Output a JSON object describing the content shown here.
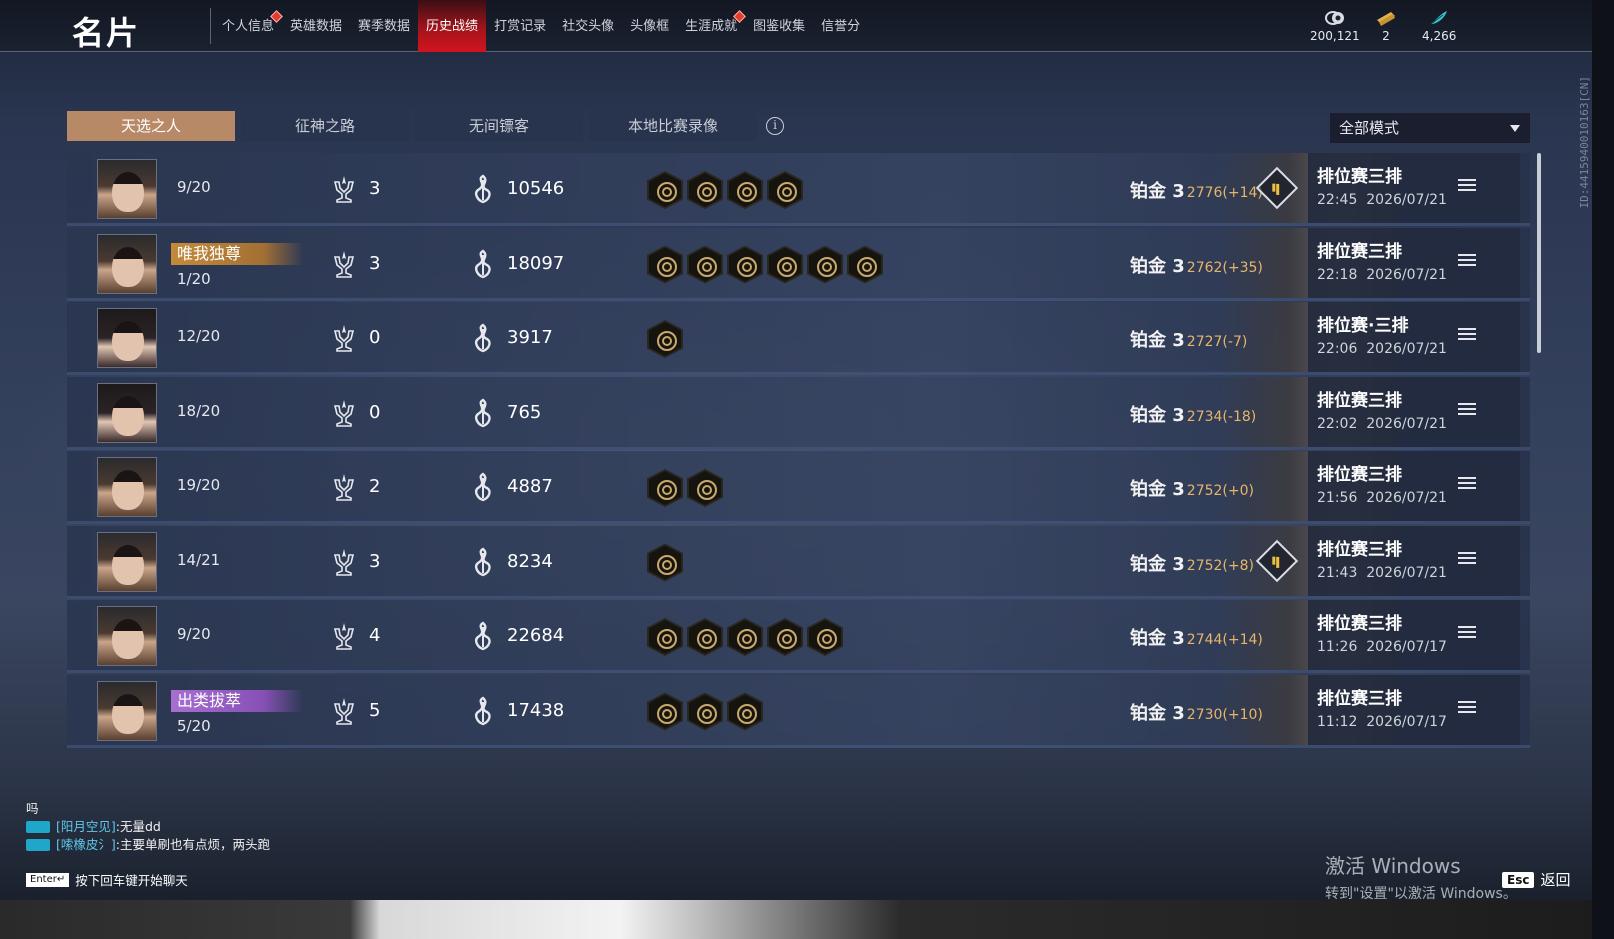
{
  "header": {
    "title": "名片",
    "tabs": [
      {
        "label": "个人信息",
        "dot": true
      },
      {
        "label": "英雄数据",
        "dot": false
      },
      {
        "label": "赛季数据",
        "dot": false
      },
      {
        "label": "历史战绩",
        "dot": false,
        "active": true
      },
      {
        "label": "打赏记录",
        "dot": false
      },
      {
        "label": "社交头像",
        "dot": false
      },
      {
        "label": "头像框",
        "dot": false
      },
      {
        "label": "生涯成就",
        "dot": true
      },
      {
        "label": "图鉴收集",
        "dot": false
      },
      {
        "label": "信誉分",
        "dot": false
      }
    ],
    "currencies": [
      {
        "icon": "coin-icon",
        "value": "200,121"
      },
      {
        "icon": "ticket-icon",
        "value": "2"
      },
      {
        "icon": "feather-icon",
        "value": "4,266"
      }
    ]
  },
  "mode_tabs": [
    "天选之人",
    "征神之路",
    "无间镖客",
    "本地比赛录像"
  ],
  "mode_select": {
    "value": "全部模式"
  },
  "player_id": "ID:4415940010163[CN]",
  "records": [
    {
      "avatar": "male-a",
      "rank_label": "",
      "rank_style": "",
      "placement": "9/20",
      "kills": "3",
      "damage": "10546",
      "badges": 4,
      "tier": "铂金 3",
      "score": "2776(+14)",
      "stats_icon": true,
      "match_type": "排位赛三排",
      "time": "22:45",
      "date": "2026/07/21"
    },
    {
      "avatar": "male",
      "rank_label": "唯我独尊",
      "rank_style": "gold",
      "placement": "1/20",
      "kills": "3",
      "damage": "18097",
      "badges": 6,
      "tier": "铂金 3",
      "score": "2762(+35)",
      "stats_icon": false,
      "match_type": "排位赛三排",
      "time": "22:18",
      "date": "2026/07/21"
    },
    {
      "avatar": "female",
      "rank_label": "",
      "rank_style": "",
      "placement": "12/20",
      "kills": "0",
      "damage": "3917",
      "badges": 1,
      "tier": "铂金 3",
      "score": "2727(-7)",
      "stats_icon": false,
      "match_type": "排位赛·三排",
      "time": "22:06",
      "date": "2026/07/21"
    },
    {
      "avatar": "female",
      "rank_label": "",
      "rank_style": "",
      "placement": "18/20",
      "kills": "0",
      "damage": "765",
      "badges": 0,
      "tier": "铂金 3",
      "score": "2734(-18)",
      "stats_icon": false,
      "match_type": "排位赛三排",
      "time": "22:02",
      "date": "2026/07/21"
    },
    {
      "avatar": "male",
      "rank_label": "",
      "rank_style": "",
      "placement": "19/20",
      "kills": "2",
      "damage": "4887",
      "badges": 2,
      "tier": "铂金 3",
      "score": "2752(+0)",
      "stats_icon": false,
      "match_type": "排位赛三排",
      "time": "21:56",
      "date": "2026/07/21"
    },
    {
      "avatar": "male",
      "rank_label": "",
      "rank_style": "",
      "placement": "14/21",
      "kills": "3",
      "damage": "8234",
      "badges": 1,
      "tier": "铂金 3",
      "score": "2752(+8)",
      "stats_icon": true,
      "match_type": "排位赛三排",
      "time": "21:43",
      "date": "2026/07/21"
    },
    {
      "avatar": "male",
      "rank_label": "",
      "rank_style": "",
      "placement": "9/20",
      "kills": "4",
      "damage": "22684",
      "badges": 5,
      "tier": "铂金 3",
      "score": "2744(+14)",
      "stats_icon": false,
      "match_type": "排位赛三排",
      "time": "11:26",
      "date": "2026/07/17"
    },
    {
      "avatar": "male",
      "rank_label": "出类拔萃",
      "rank_style": "purple",
      "placement": "5/20",
      "kills": "5",
      "damage": "17438",
      "badges": 3,
      "tier": "铂金 3",
      "score": "2730(+10)",
      "stats_icon": false,
      "match_type": "排位赛三排",
      "time": "11:12",
      "date": "2026/07/17"
    }
  ],
  "chat": {
    "partial_line": "吗",
    "lines": [
      {
        "name": "[阳月空见]",
        "text": ":无量dd"
      },
      {
        "name": "[嗦橡皮氵]",
        "text": ":主要单刷也有点烦，两头跑"
      }
    ],
    "enter_key": "Enter↵",
    "enter_hint": "按下回车键开始聊天"
  },
  "windows_activation": {
    "title": "激活 Windows",
    "subtitle": "转到\"设置\"以激活 Windows。"
  },
  "esc": {
    "key": "Esc",
    "label": "返回"
  }
}
